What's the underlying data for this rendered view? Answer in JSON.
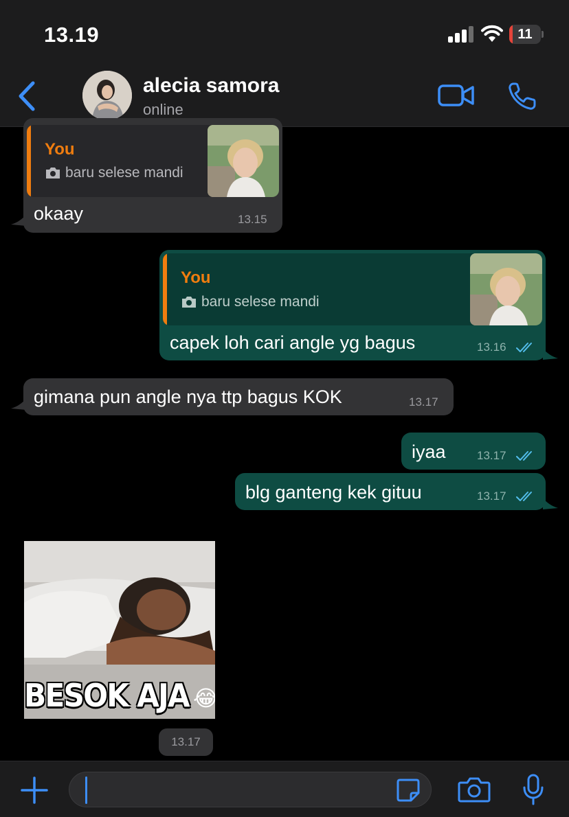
{
  "status_bar": {
    "time": "13.19",
    "battery": "11",
    "battery_level": 0.11
  },
  "header": {
    "contact_name": "alecia samora",
    "status": "online"
  },
  "messages": [
    {
      "direction": "incoming",
      "reply": {
        "author": "You",
        "caption": "baru selese mandi"
      },
      "text": "okaay",
      "time": "13.15"
    },
    {
      "direction": "outgoing",
      "reply": {
        "author": "You",
        "caption": "baru selese mandi"
      },
      "text": "capek loh cari angle yg bagus",
      "time": "13.16",
      "read": true
    },
    {
      "direction": "incoming",
      "text": "gimana pun angle nya ttp bagus KOK",
      "time": "13.17"
    },
    {
      "direction": "outgoing",
      "text": "iyaa",
      "time": "13.17",
      "read": true
    },
    {
      "direction": "outgoing",
      "text": "blg ganteng kek gituu",
      "time": "13.17",
      "read": true
    },
    {
      "direction": "incoming",
      "sticker": {
        "caption": "BESOK AJA",
        "emoji": "😂"
      },
      "time": "13.17"
    }
  ],
  "composer": {
    "value": ""
  },
  "colors": {
    "accent": "#3d8ef7",
    "incoming_bubble": "#333335",
    "outgoing_bubble": "#0e4c43",
    "reply_author": "#f07d0f",
    "read_ticks": "#53bdeb"
  },
  "icons": {
    "back": "chevron-left-icon",
    "video": "video-camera-icon",
    "call": "phone-icon",
    "attach": "plus-icon",
    "sticker": "sticker-icon",
    "camera": "camera-icon",
    "mic": "microphone-icon"
  }
}
